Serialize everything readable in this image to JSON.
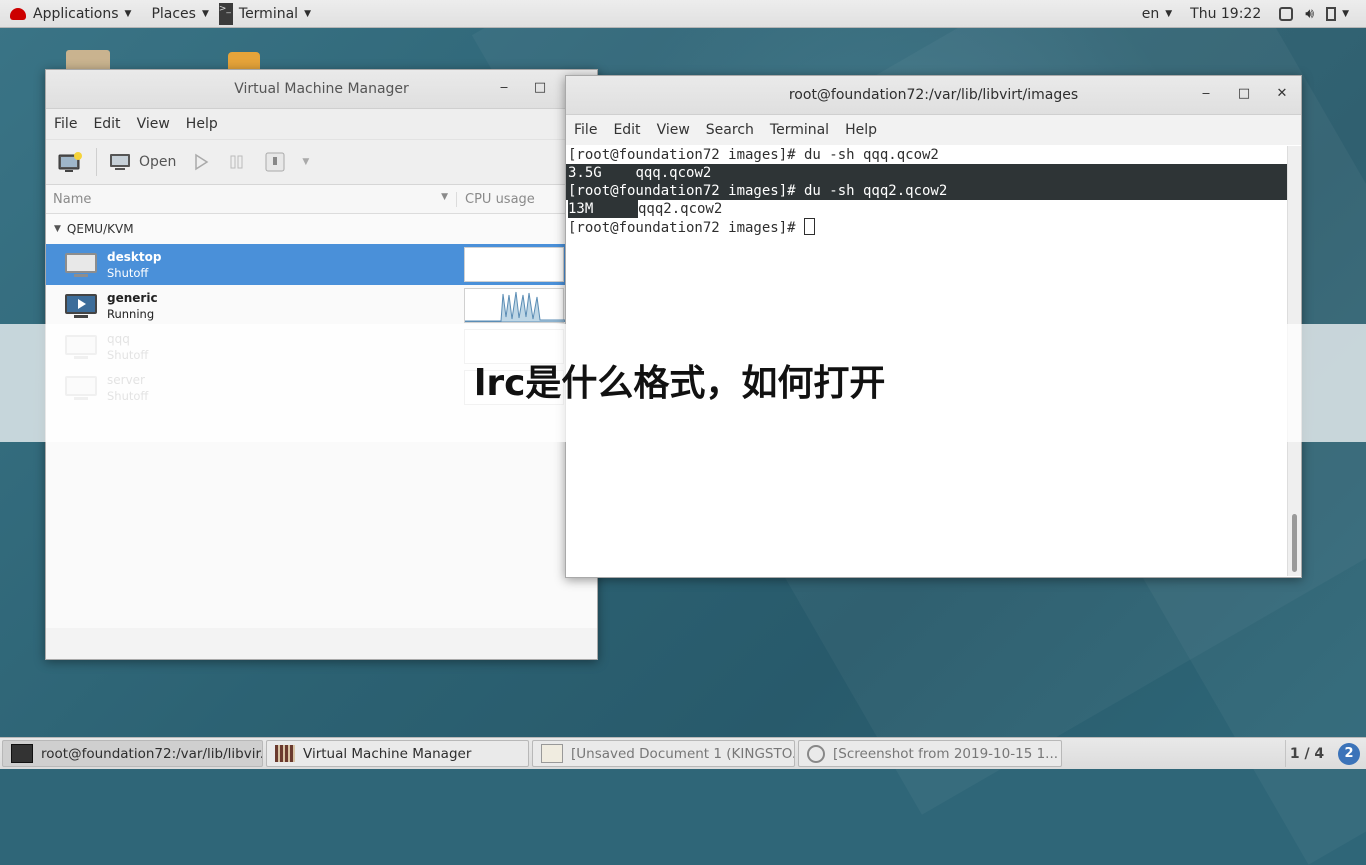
{
  "topbar": {
    "applications_label": "Applications",
    "places_label": "Places",
    "terminal_label": "Terminal",
    "language": "en",
    "clock": "Thu 19:22"
  },
  "vmm": {
    "title": "Virtual Machine Manager",
    "menu": [
      "File",
      "Edit",
      "View",
      "Help"
    ],
    "toolbar": {
      "open_label": "Open"
    },
    "columns": {
      "name": "Name",
      "cpu": "CPU usage"
    },
    "group": "QEMU/KVM",
    "vms": [
      {
        "name": "desktop",
        "state": "Shutoff",
        "selected": true
      },
      {
        "name": "generic",
        "state": "Running",
        "selected": false
      },
      {
        "name": "qqq",
        "state": "Shutoff",
        "selected": false
      },
      {
        "name": "server",
        "state": "Shutoff",
        "selected": false
      }
    ]
  },
  "terminal": {
    "title": "root@foundation72:/var/lib/libvirt/images",
    "menu": [
      "File",
      "Edit",
      "View",
      "Search",
      "Terminal",
      "Help"
    ],
    "lines": [
      "[root@foundation72 images]# du -sh qqq.qcow2",
      "3.5G\tqqq.qcow2",
      "[root@foundation72 images]# du -sh qqq2.qcow2",
      "13M",
      "qqq2.qcow2",
      "[root@foundation72 images]# "
    ]
  },
  "overlay": {
    "text": "lrc是什么格式，如何打开"
  },
  "taskbar": {
    "tasks": [
      "root@foundation72:/var/lib/libvir...",
      "Virtual Machine Manager",
      "[Unsaved Document 1 (KINGSTO...",
      "[Screenshot from 2019-10-15 1..."
    ],
    "pager": "1 / 4",
    "notification_count": "2"
  },
  "colors": {
    "selection": "#4a90d9",
    "terminal_highlight": "#2e3436",
    "notification": "#3b73b9"
  }
}
